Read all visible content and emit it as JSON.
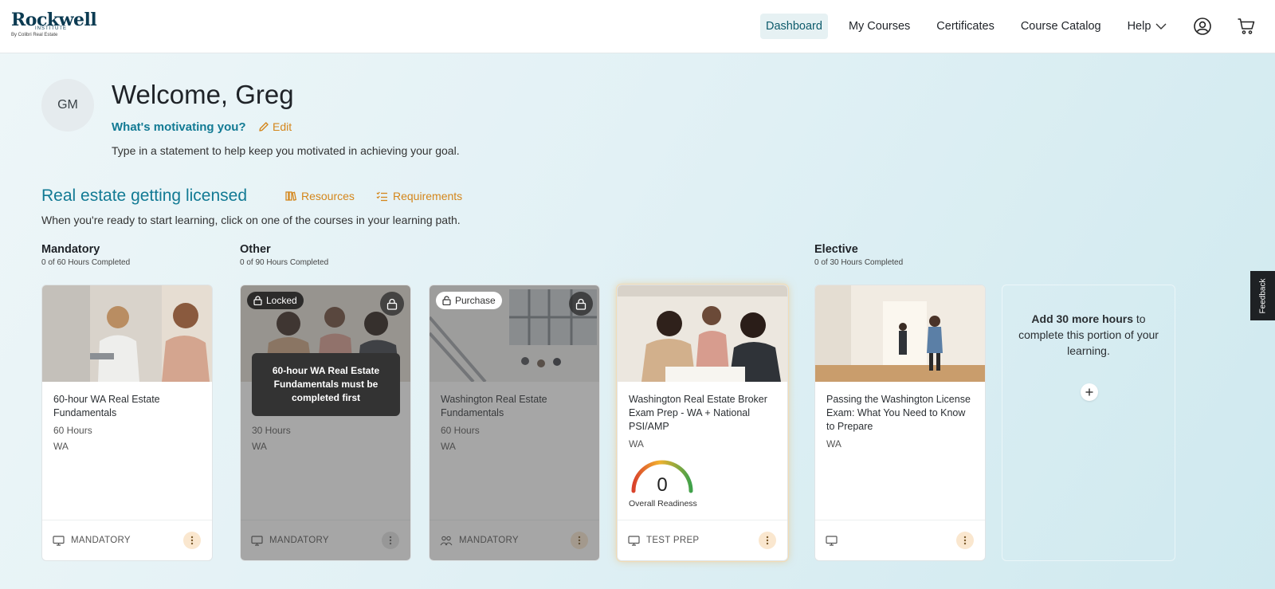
{
  "header": {
    "logo": {
      "main": "Rockwell",
      "sub": "INSTITUTE",
      "by": "By Colibri Real Estate"
    },
    "nav": [
      {
        "label": "Dashboard",
        "active": true
      },
      {
        "label": "My Courses"
      },
      {
        "label": "Certificates"
      },
      {
        "label": "Course Catalog"
      },
      {
        "label": "Help"
      }
    ],
    "icons": [
      "user-icon",
      "cart-icon"
    ]
  },
  "profile": {
    "initials": "GM",
    "welcome": "Welcome, Greg",
    "motivating_label": "What's motivating you?",
    "edit_label": "Edit",
    "statement": "Type in a statement to help keep you motivated in achieving your goal."
  },
  "path": {
    "title": "Real estate getting licensed",
    "resources_label": "Resources",
    "requirements_label": "Requirements",
    "description": "When you're ready to start learning, click on one of the courses in your learning path."
  },
  "groups": [
    {
      "name": "Mandatory",
      "hours": "0 of 60 Hours Completed"
    },
    {
      "name": "Other",
      "hours": "0 of 90 Hours Completed"
    },
    {
      "name": "Elective",
      "hours": "0 of 30 Hours Completed"
    }
  ],
  "cards": [
    {
      "title": "60-hour WA Real Estate Fundamentals",
      "hours": "60 Hours",
      "state": "WA",
      "footer": "MANDATORY"
    },
    {
      "title": "",
      "hours": "30 Hours",
      "state": "WA",
      "footer": "MANDATORY",
      "pill": "Locked",
      "tooltip": "60-hour WA Real Estate Fundamentals must be completed first"
    },
    {
      "title": "Washington Real Estate Fundamentals",
      "hours": "60 Hours",
      "state": "WA",
      "footer": "MANDATORY",
      "pill": "Purchase"
    },
    {
      "title": "Washington Real Estate Broker Exam Prep - WA + National PSI/AMP",
      "state": "WA",
      "footer": "TEST PREP",
      "readiness_value": "0",
      "readiness_label": "Overall Readiness",
      "readiness_fraction": 0
    },
    {
      "title": "Passing the Washington License Exam: What You Need to Know to Prepare",
      "state": "WA",
      "footer": ""
    }
  ],
  "add_more": {
    "bold": "Add 30 more hours",
    "rest": " to complete this portion of your learning."
  },
  "feedback_label": "Feedback",
  "colors": {
    "teal": "#127a94",
    "orange": "#d4861b",
    "navy": "#0c3b52"
  }
}
